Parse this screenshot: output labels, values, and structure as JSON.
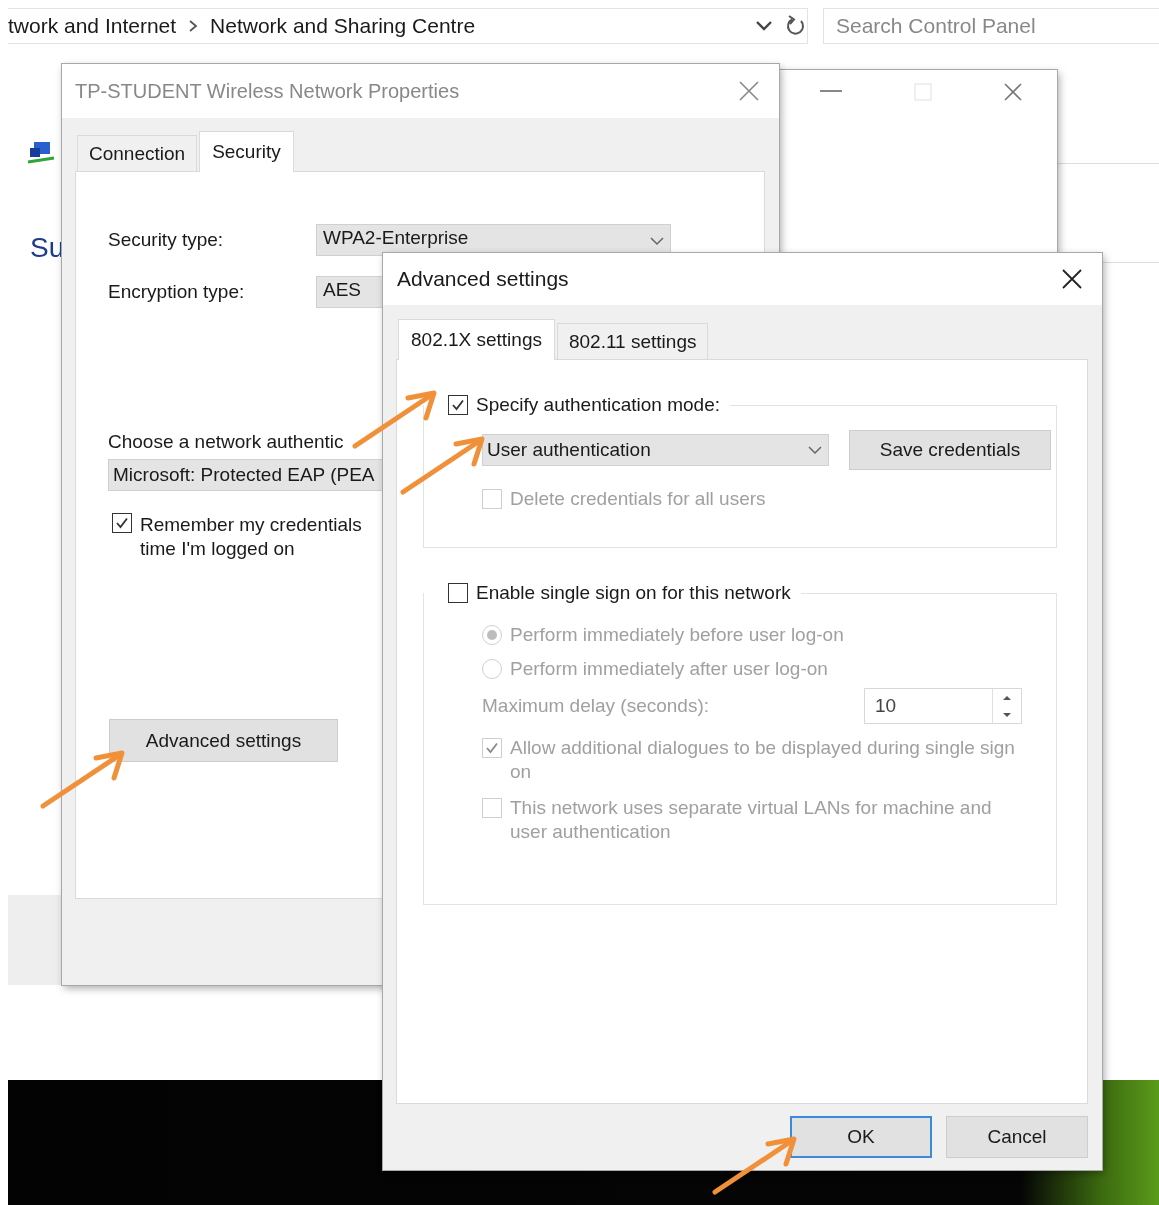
{
  "explorer": {
    "breadcrumb": [
      "twork and Internet",
      "Network and Sharing Centre"
    ],
    "search": {
      "placeholder": "Search Control Panel"
    },
    "sidebar_text": "Su"
  },
  "properties_dialog": {
    "title": "TP-STUDENT Wireless Network Properties",
    "tabs": [
      {
        "label": "Connection",
        "selected": false
      },
      {
        "label": "Security",
        "selected": true
      }
    ],
    "fields": [
      {
        "label": "Security type:",
        "value": "WPA2-Enterprise"
      },
      {
        "label": "Encryption type:",
        "value": "AES"
      }
    ],
    "auth_label": "Choose a network authentic",
    "auth_method": "Microsoft: Protected EAP (PEA",
    "remember": {
      "label": "Remember my credentials time I'm logged on",
      "checked": true
    },
    "advanced_button": "Advanced settings"
  },
  "advanced_dialog": {
    "title": "Advanced settings",
    "tabs": [
      {
        "label": "802.1X settings",
        "selected": true
      },
      {
        "label": "802.11 settings",
        "selected": false
      }
    ],
    "specify": {
      "label": "Specify authentication mode:",
      "checked": true
    },
    "auth_mode": "User authentication",
    "save_button": "Save credentials",
    "delete_credentials": {
      "label": "Delete credentials for all users",
      "checked": false,
      "disabled": true
    },
    "sso": {
      "label": "Enable single sign on for this network",
      "checked": false
    },
    "sso_options": [
      {
        "label": "Perform immediately before user log-on",
        "selected": true,
        "disabled": true
      },
      {
        "label": "Perform immediately after user log-on",
        "selected": false,
        "disabled": true
      }
    ],
    "max_delay": {
      "label": "Maximum delay (seconds):",
      "value": "10",
      "disabled": true
    },
    "sso_checks": [
      {
        "label": "Allow additional dialogues to be displayed during single sign on",
        "checked": true,
        "disabled": true
      },
      {
        "label": "This network uses separate virtual LANs for machine and user authentication",
        "checked": false,
        "disabled": true
      }
    ],
    "buttons": [
      {
        "label": "OK",
        "focused": true
      },
      {
        "label": "Cancel",
        "focused": false
      }
    ]
  }
}
